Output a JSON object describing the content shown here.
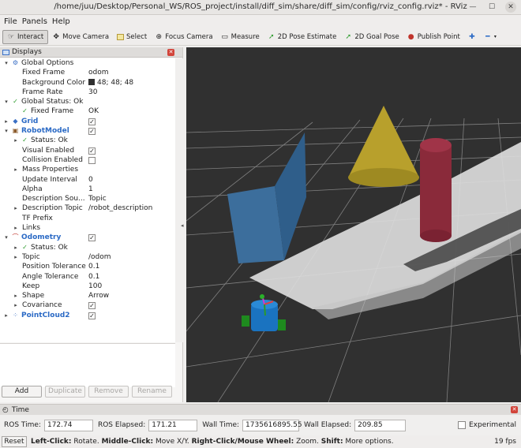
{
  "window": {
    "title": "/home/juu/Desktop/Personal_WS/ROS_project/install/diff_sim/share/diff_sim/config/rviz_config.rviz* - RViz"
  },
  "menu": [
    "File",
    "Panels",
    "Help"
  ],
  "toolbar": [
    {
      "label": "Interact",
      "icon": "interact-icon",
      "active": true
    },
    {
      "label": "Move Camera",
      "icon": "move-camera-icon"
    },
    {
      "label": "Select",
      "icon": "select-icon"
    },
    {
      "label": "Focus Camera",
      "icon": "focus-camera-icon"
    },
    {
      "label": "Measure",
      "icon": "measure-icon"
    },
    {
      "label": "2D Pose Estimate",
      "icon": "pose-estimate-icon"
    },
    {
      "label": "2D Goal Pose",
      "icon": "goal-pose-icon"
    },
    {
      "label": "Publish Point",
      "icon": "publish-point-icon"
    }
  ],
  "displays": {
    "title": "Displays",
    "rows": [
      {
        "name": "Global Options",
        "indent": 0,
        "expand": "▾",
        "icon": "⚙",
        "iconColor": "#3a6fc5"
      },
      {
        "name": "Fixed Frame",
        "value": "odom",
        "indent": 1
      },
      {
        "name": "Background Color",
        "value": "48; 48; 48",
        "indent": 1,
        "swatch": true
      },
      {
        "name": "Frame Rate",
        "value": "30",
        "indent": 1
      },
      {
        "name": "Global Status: Ok",
        "indent": 0,
        "expand": "▾",
        "icon": "✓",
        "iconColor": "#2a9a2a"
      },
      {
        "name": "Fixed Frame",
        "value": "OK",
        "indent": 1,
        "icon": "✓",
        "iconColor": "#2a9a2a"
      },
      {
        "name": "Grid",
        "indent": 0,
        "expand": "▸",
        "icon": "◆",
        "iconColor": "#3a6fc5",
        "blue": true,
        "check": true
      },
      {
        "name": "RobotModel",
        "indent": 0,
        "expand": "▾",
        "icon": "▣",
        "iconColor": "#8a5a2a",
        "blue": true,
        "check": true
      },
      {
        "name": "Status: Ok",
        "indent": 1,
        "expand": "▸",
        "icon": "✓",
        "iconColor": "#2a9a2a"
      },
      {
        "name": "Visual Enabled",
        "indent": 1,
        "check": true
      },
      {
        "name": "Collision Enabled",
        "indent": 1,
        "check": false
      },
      {
        "name": "Mass Properties",
        "indent": 1,
        "expand": "▸"
      },
      {
        "name": "Update Interval",
        "value": "0",
        "indent": 1
      },
      {
        "name": "Alpha",
        "value": "1",
        "indent": 1
      },
      {
        "name": "Description Sou...",
        "value": "Topic",
        "indent": 1
      },
      {
        "name": "Description Topic",
        "value": "/robot_description",
        "indent": 1,
        "expand": "▸"
      },
      {
        "name": "TF Prefix",
        "indent": 1
      },
      {
        "name": "Links",
        "indent": 1,
        "expand": "▸"
      },
      {
        "name": "Odometry",
        "indent": 0,
        "expand": "▾",
        "icon": "⌒",
        "iconColor": "#c0342c",
        "blue": true,
        "check": true
      },
      {
        "name": "Status: Ok",
        "indent": 1,
        "expand": "▸",
        "icon": "✓",
        "iconColor": "#2a9a2a"
      },
      {
        "name": "Topic",
        "value": "/odom",
        "indent": 1,
        "expand": "▸"
      },
      {
        "name": "Position Tolerance",
        "value": "0.1",
        "indent": 1
      },
      {
        "name": "Angle Tolerance",
        "value": "0.1",
        "indent": 1
      },
      {
        "name": "Keep",
        "value": "100",
        "indent": 1
      },
      {
        "name": "Shape",
        "value": "Arrow",
        "indent": 1,
        "expand": "▸"
      },
      {
        "name": "Covariance",
        "indent": 1,
        "expand": "▸",
        "check": true
      },
      {
        "name": "PointCloud2",
        "indent": 0,
        "expand": "▸",
        "icon": "⁘",
        "iconColor": "#3a6fc5",
        "blue": true,
        "check": true
      }
    ],
    "buttons": [
      {
        "label": "Add",
        "enabled": true
      },
      {
        "label": "Duplicate",
        "enabled": false
      },
      {
        "label": "Remove",
        "enabled": false
      },
      {
        "label": "Rename",
        "enabled": false
      }
    ]
  },
  "time": {
    "title": "Time",
    "ros_time_label": "ROS Time:",
    "ros_time": "172.74",
    "ros_elapsed_label": "ROS Elapsed:",
    "ros_elapsed": "171.21",
    "wall_time_label": "Wall Time:",
    "wall_time": "1735616895.55",
    "wall_elapsed_label": "Wall Elapsed:",
    "wall_elapsed": "209.85",
    "experimental_label": "Experimental"
  },
  "status": {
    "reset": "Reset",
    "hint_parts": [
      {
        "b": "Left-Click:",
        "t": " Rotate. "
      },
      {
        "b": "Middle-Click:",
        "t": " Move X/Y. "
      },
      {
        "b": "Right-Click/Mouse Wheel:",
        "t": " Zoom. "
      },
      {
        "b": "Shift:",
        "t": " More options."
      }
    ],
    "fps": "19 fps"
  },
  "scene": {
    "background": "#303030",
    "grid_color": "#a0a0a0",
    "wall_color": "#3c6e9c",
    "cone_color": "#b8a02c",
    "cylinder_color": "#8a2a3a",
    "cloud_color": "#e8e8e8"
  }
}
